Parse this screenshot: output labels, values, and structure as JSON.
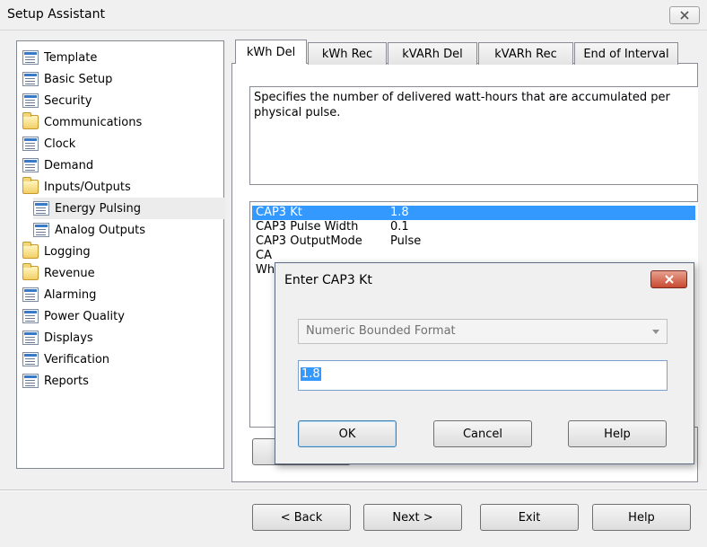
{
  "window": {
    "title": "Setup Assistant"
  },
  "tree": {
    "items": [
      {
        "label": "Template",
        "icon": "document-icon"
      },
      {
        "label": "Basic Setup",
        "icon": "document-icon"
      },
      {
        "label": "Security",
        "icon": "document-icon"
      },
      {
        "label": "Communications",
        "icon": "folder-icon"
      },
      {
        "label": "Clock",
        "icon": "document-icon"
      },
      {
        "label": "Demand",
        "icon": "document-icon"
      },
      {
        "label": "Inputs/Outputs",
        "icon": "folder-icon"
      },
      {
        "label": "Energy Pulsing",
        "icon": "document-icon",
        "selected": true
      },
      {
        "label": "Analog Outputs",
        "icon": "document-icon"
      },
      {
        "label": "Logging",
        "icon": "folder-icon"
      },
      {
        "label": "Revenue",
        "icon": "folder-icon"
      },
      {
        "label": "Alarming",
        "icon": "document-icon"
      },
      {
        "label": "Power Quality",
        "icon": "document-icon"
      },
      {
        "label": "Displays",
        "icon": "document-icon"
      },
      {
        "label": "Verification",
        "icon": "document-icon"
      },
      {
        "label": "Reports",
        "icon": "document-icon"
      }
    ]
  },
  "tabs": [
    {
      "label": "kWh Del",
      "active": true
    },
    {
      "label": "kWh Rec"
    },
    {
      "label": "kVARh Del"
    },
    {
      "label": "kVARh Rec"
    },
    {
      "label": "End of Interval"
    }
  ],
  "description": "Specifies the number of delivered watt-hours that are accumulated per physical pulse.",
  "registers": [
    {
      "name": "CAP3 Kt",
      "value": "1.8",
      "selected": true
    },
    {
      "name": "CAP3 Pulse Width",
      "value": "0.1"
    },
    {
      "name": "CAP3 OutputMode",
      "value": "Pulse"
    },
    {
      "name": "CA",
      "value": ""
    },
    {
      "name": "Wh",
      "value": ""
    }
  ],
  "dialog": {
    "title": "Enter CAP3 Kt",
    "format": "Numeric Bounded Format",
    "value": "1.8",
    "ok_label": "OK",
    "cancel_label": "Cancel",
    "help_label": "Help"
  },
  "footer": {
    "back_label": "< Back",
    "next_label": "Next >",
    "exit_label": "Exit",
    "help_label": "Help"
  },
  "colors": {
    "selection": "#3399ff",
    "close_red": "#c84a30"
  }
}
